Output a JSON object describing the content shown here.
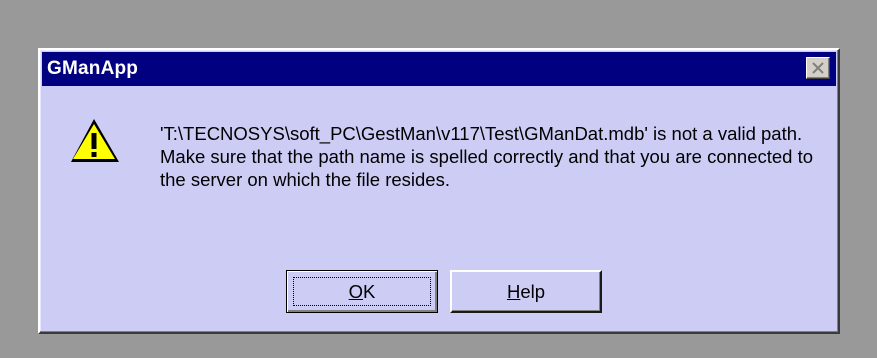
{
  "window": {
    "title": "GManApp",
    "close_icon": "close-icon"
  },
  "message": {
    "icon": "warning-icon",
    "text": "'T:\\TECNOSYS\\soft_PC\\GestMan\\v117\\Test\\GManDat.mdb' is not a valid path.  Make sure that the path name is spelled correctly and that you are connected to the server on which the file resides."
  },
  "buttons": {
    "ok_accel": "O",
    "ok_rest": "K",
    "help_accel": "H",
    "help_rest": "elp"
  },
  "colors": {
    "titlebar": "#000080",
    "dialog_bg": "#ccccf5",
    "desktop_bg": "#999999",
    "warning_yellow": "#ffff00"
  }
}
